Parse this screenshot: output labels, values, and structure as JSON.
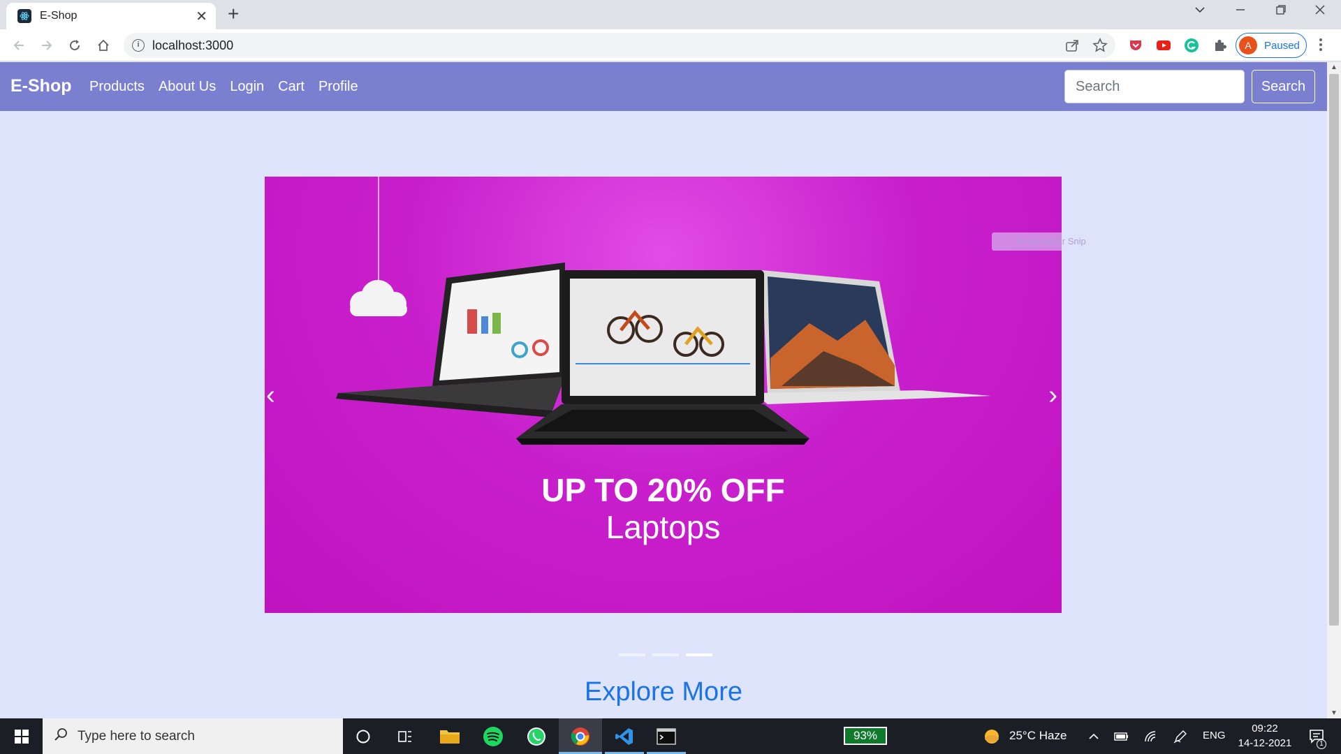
{
  "browser": {
    "tab_title": "E-Shop",
    "url": "localhost:3000",
    "profile_status": "Paused",
    "profile_initial": "A"
  },
  "navbar": {
    "brand": "E-Shop",
    "links": [
      "Products",
      "About Us",
      "Login",
      "Cart",
      "Profile"
    ],
    "search_placeholder": "Search",
    "search_button": "Search"
  },
  "carousel": {
    "headline_1": "UP TO 20% OFF",
    "headline_2": "Laptops",
    "slide_count": 3,
    "active_slide": 3,
    "ghost_overlay_text": "Rectangular Snip"
  },
  "section": {
    "explore_heading": "Explore More"
  },
  "taskbar": {
    "search_placeholder": "Type here to search",
    "battery": "93%",
    "weather": "25°C  Haze",
    "language": "ENG",
    "time": "09:22",
    "date": "14-12-2021",
    "notification_count": "1"
  },
  "colors": {
    "navbar": "#7a7fcf",
    "page_bg": "#dde4fb",
    "banner": "#c013c0",
    "link_blue": "#1a73e8"
  }
}
